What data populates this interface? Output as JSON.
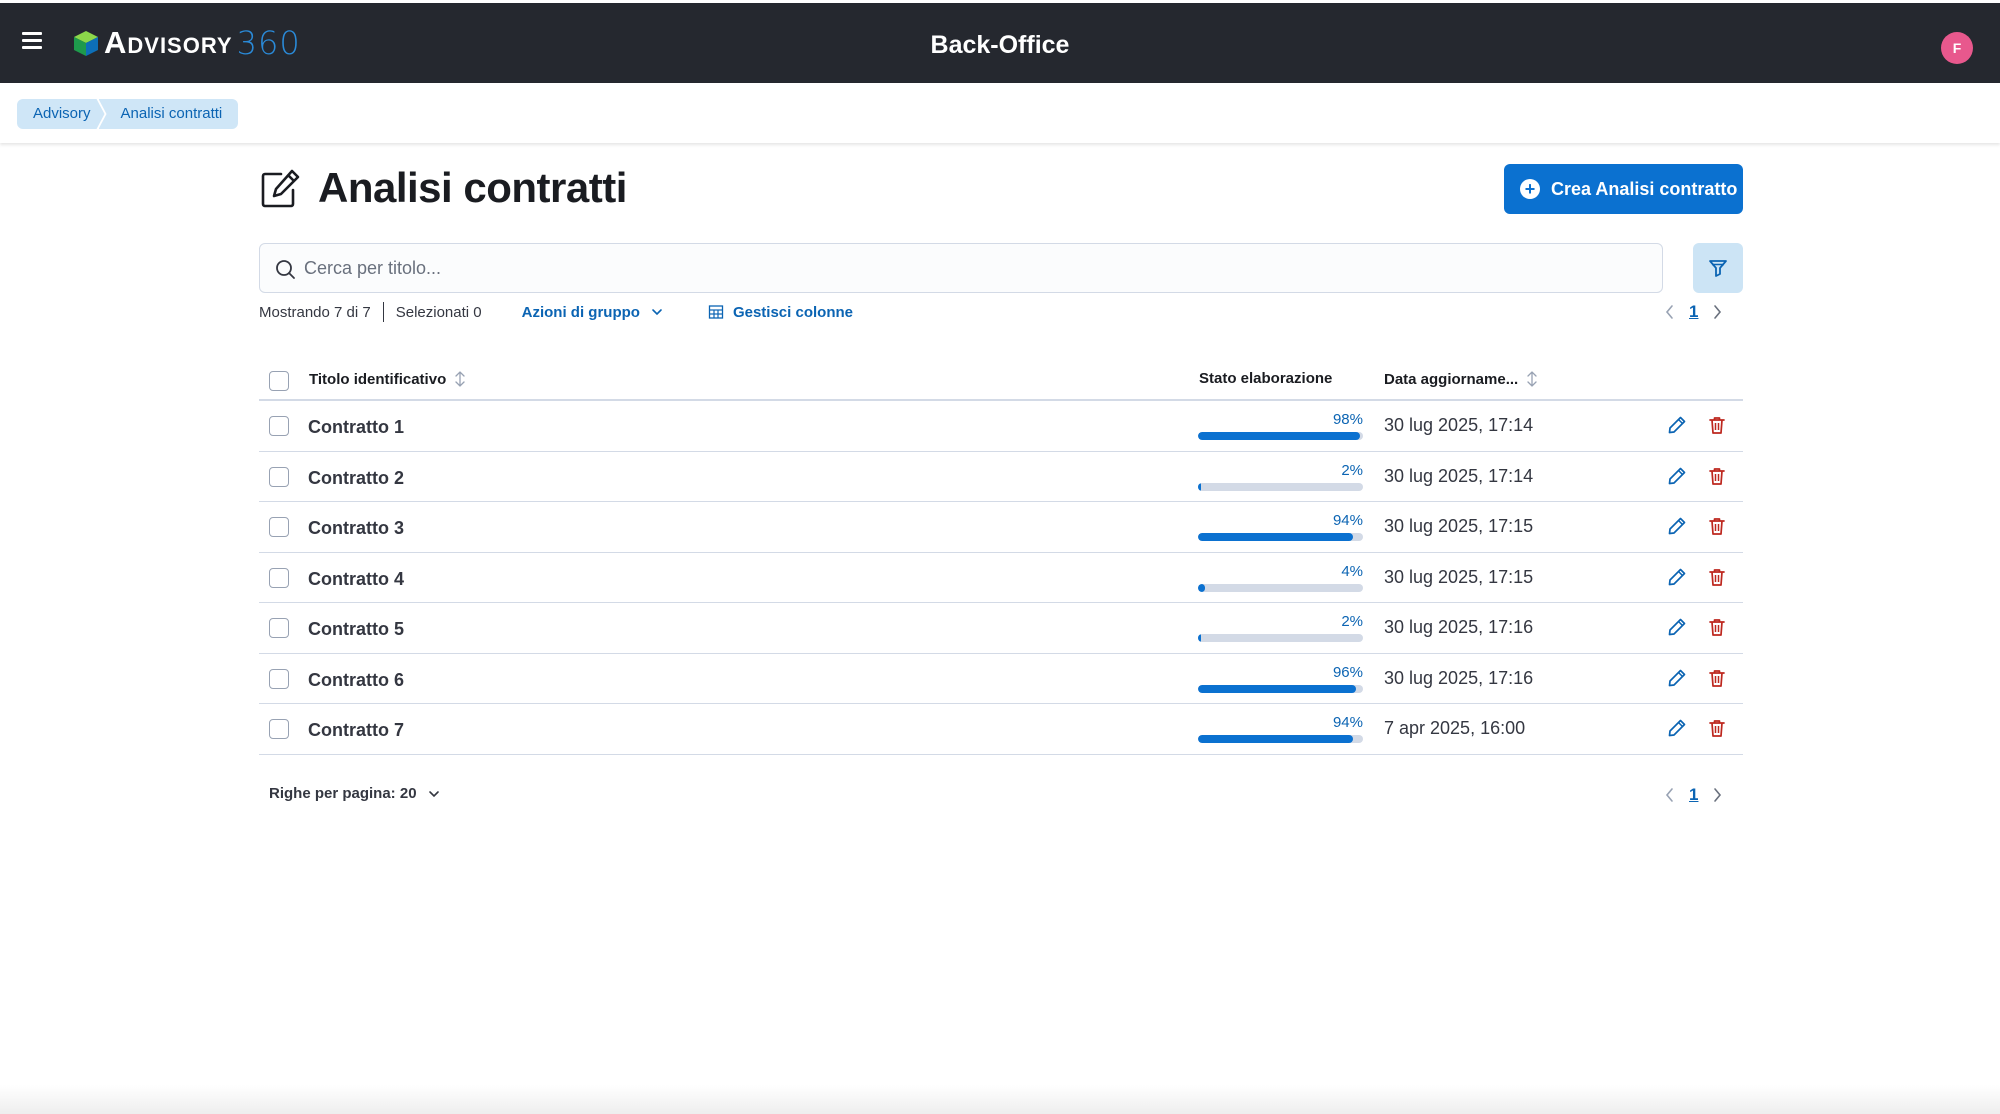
{
  "header": {
    "logo_word": "Advisory",
    "logo_number": "360",
    "app_title": "Back-Office",
    "avatar_initial": "F",
    "avatar_color": "#e8588d",
    "menu_icon": "hamburger-icon"
  },
  "breadcrumb": [
    "Advisory",
    "Analisi contratti"
  ],
  "page": {
    "title": "Analisi contratti",
    "title_icon": "edit-document-icon",
    "create_button": "Crea Analisi contratto",
    "accent_color": "#0b71d0"
  },
  "search": {
    "placeholder": "Cerca per titolo...",
    "value": ""
  },
  "toolbar": {
    "showing": "Mostrando 7 di 7",
    "selected": "Selezionati 0",
    "group_actions": "Azioni di gruppo",
    "manage_columns": "Gestisci colonne"
  },
  "pagination": {
    "current_page": "1"
  },
  "table": {
    "columns": {
      "title": "Titolo identificativo",
      "status": "Stato elaborazione",
      "date": "Data aggiorname..."
    },
    "rows": [
      {
        "title": "Contratto 1",
        "progress_label": "98%",
        "progress": 98,
        "date": "30 lug 2025, 17:14"
      },
      {
        "title": "Contratto 2",
        "progress_label": "2%",
        "progress": 2,
        "date": "30 lug 2025, 17:14"
      },
      {
        "title": "Contratto 3",
        "progress_label": "94%",
        "progress": 94,
        "date": "30 lug 2025, 17:15"
      },
      {
        "title": "Contratto 4",
        "progress_label": "4%",
        "progress": 4,
        "date": "30 lug 2025, 17:15"
      },
      {
        "title": "Contratto 5",
        "progress_label": "2%",
        "progress": 2,
        "date": "30 lug 2025, 17:16"
      },
      {
        "title": "Contratto 6",
        "progress_label": "96%",
        "progress": 96,
        "date": "30 lug 2025, 17:16"
      },
      {
        "title": "Contratto 7",
        "progress_label": "94%",
        "progress": 94,
        "date": "7 apr 2025, 16:00"
      }
    ]
  },
  "footer": {
    "rows_per_page": "Righe per pagina: 20"
  }
}
